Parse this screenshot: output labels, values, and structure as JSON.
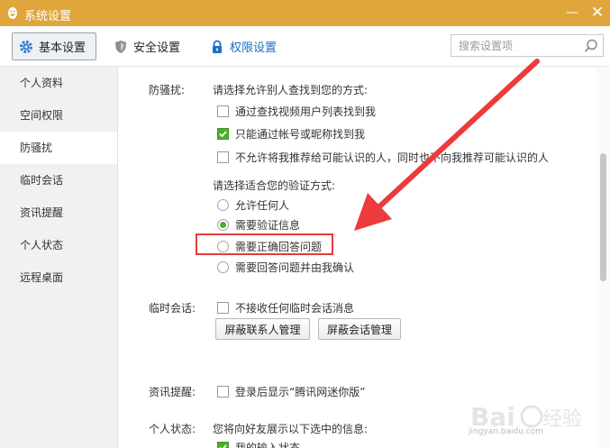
{
  "window": {
    "title": "系统设置",
    "minimize_glyph": "—",
    "close_glyph": "✕"
  },
  "toolbar": {
    "tabs": [
      {
        "label": "基本设置",
        "icon": "gear-icon",
        "active": true
      },
      {
        "label": "安全设置",
        "icon": "shield-icon",
        "active": false
      },
      {
        "label": "权限设置",
        "icon": "lock-icon",
        "active": false
      }
    ],
    "search_placeholder": "搜索设置项"
  },
  "sidebar": {
    "items": [
      {
        "label": "个人资料",
        "active": false
      },
      {
        "label": "空间权限",
        "active": false
      },
      {
        "label": "防骚扰",
        "active": true
      },
      {
        "label": "临时会话",
        "active": false
      },
      {
        "label": "资讯提醒",
        "active": false
      },
      {
        "label": "个人状态",
        "active": false
      },
      {
        "label": "远程桌面",
        "active": false
      }
    ]
  },
  "anti_harass": {
    "label": "防骚扰:",
    "find_prompt": "请选择允许别人查找到您的方式:",
    "find_options": [
      {
        "label": "通过查找视频用户列表找到我",
        "checked": false
      },
      {
        "label": "只能通过帐号或昵称找到我",
        "checked": true
      },
      {
        "label": "不允许将我推荐给可能认识的人，同时也不向我推荐可能认识的人",
        "checked": false
      }
    ],
    "verify_prompt": "请选择适合您的验证方式:",
    "verify_options": [
      {
        "label": "允许任何人",
        "selected": false
      },
      {
        "label": "需要验证信息",
        "selected": true
      },
      {
        "label": "需要正确回答问题",
        "selected": false
      },
      {
        "label": "需要回答问题并由我确认",
        "selected": false
      }
    ]
  },
  "temp_session": {
    "label": "临时会话:",
    "option": {
      "label": "不接收任何临时会话消息",
      "checked": false
    },
    "buttons": [
      "屏蔽联系人管理",
      "屏蔽会话管理"
    ]
  },
  "news": {
    "label": "资讯提醒:",
    "option": {
      "label": "登录后显示“腾讯网迷你版”",
      "checked": false
    }
  },
  "status": {
    "label": "个人状态:",
    "prompt": "您将向好友展示以下选中的信息:",
    "option": {
      "label": "我的输入状态",
      "checked": true
    }
  },
  "colors": {
    "title_bar": "#e0a63b",
    "accent_green": "#4caf2c",
    "highlight_red": "#e63a3a",
    "link_blue": "#1c6fc6"
  },
  "watermark": {
    "text": "Baidu经验",
    "url": "jingyan.baidu.com"
  }
}
